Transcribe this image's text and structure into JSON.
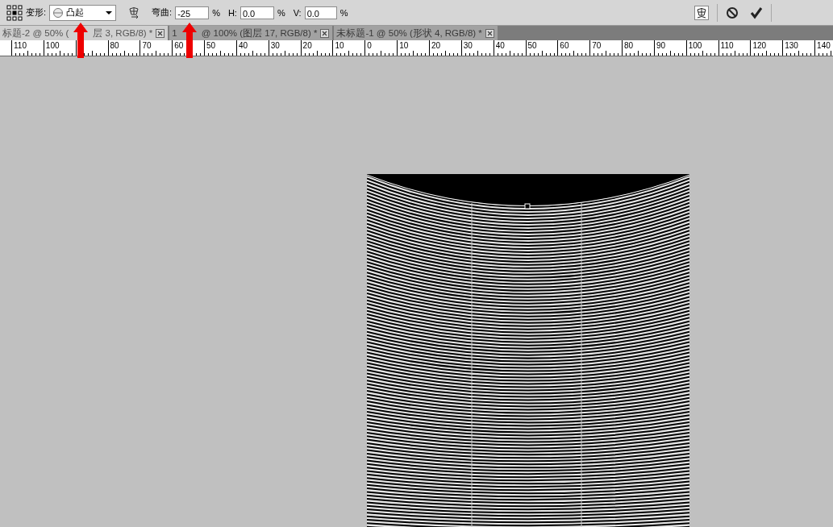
{
  "options_bar": {
    "warp_label": "变形:",
    "warp_style": "凸起",
    "bend_label": "弯曲:",
    "bend_value": "-25",
    "bend_unit": "%",
    "h_label": "H:",
    "h_value": "0.0",
    "h_unit": "%",
    "v_label": "V:",
    "v_value": "0.0",
    "v_unit": "%"
  },
  "tabs": [
    {
      "parts": [
        "标题-2 @ 50% (",
        "层 3, RGB/8) *"
      ],
      "selected": true
    },
    {
      "parts": [
        "1",
        "@ 100% (图层 17, RGB/8) *"
      ],
      "selected": false
    },
    {
      "parts": [
        "未标题-1 @ 50% (形状 4, RGB/8) *"
      ],
      "selected": false
    }
  ],
  "ruler": [
    {
      "kind": "label",
      "text": "110"
    },
    {
      "kind": "label",
      "text": "100"
    },
    {
      "kind": "covered"
    },
    {
      "kind": "label",
      "text": "80"
    },
    {
      "kind": "label",
      "text": "70"
    },
    {
      "kind": "label",
      "text": "60"
    },
    {
      "kind": "label",
      "text": "50"
    },
    {
      "kind": "label",
      "text": "40"
    },
    {
      "kind": "label",
      "text": "30"
    },
    {
      "kind": "label",
      "text": "20"
    },
    {
      "kind": "label",
      "text": "10"
    },
    {
      "kind": "label",
      "text": "0"
    },
    {
      "kind": "label",
      "text": "10"
    },
    {
      "kind": "label",
      "text": "20"
    },
    {
      "kind": "label",
      "text": "30"
    },
    {
      "kind": "label",
      "text": "40"
    },
    {
      "kind": "label",
      "text": "50"
    },
    {
      "kind": "label",
      "text": "60"
    },
    {
      "kind": "label",
      "text": "70"
    },
    {
      "kind": "label",
      "text": "80"
    },
    {
      "kind": "label",
      "text": "90"
    },
    {
      "kind": "label",
      "text": "100"
    },
    {
      "kind": "label",
      "text": "110"
    },
    {
      "kind": "label",
      "text": "120"
    },
    {
      "kind": "label",
      "text": "130"
    },
    {
      "kind": "label",
      "text": "140"
    }
  ]
}
